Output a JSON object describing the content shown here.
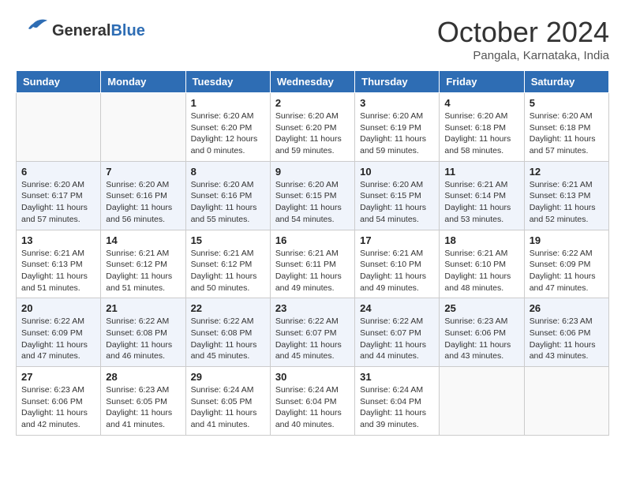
{
  "header": {
    "logo_general": "General",
    "logo_blue": "Blue",
    "month_title": "October 2024",
    "location": "Pangala, Karnataka, India"
  },
  "weekdays": [
    "Sunday",
    "Monday",
    "Tuesday",
    "Wednesday",
    "Thursday",
    "Friday",
    "Saturday"
  ],
  "weeks": [
    [
      {
        "day": "",
        "info": ""
      },
      {
        "day": "",
        "info": ""
      },
      {
        "day": "1",
        "info": "Sunrise: 6:20 AM\nSunset: 6:20 PM\nDaylight: 12 hours\nand 0 minutes."
      },
      {
        "day": "2",
        "info": "Sunrise: 6:20 AM\nSunset: 6:20 PM\nDaylight: 11 hours\nand 59 minutes."
      },
      {
        "day": "3",
        "info": "Sunrise: 6:20 AM\nSunset: 6:19 PM\nDaylight: 11 hours\nand 59 minutes."
      },
      {
        "day": "4",
        "info": "Sunrise: 6:20 AM\nSunset: 6:18 PM\nDaylight: 11 hours\nand 58 minutes."
      },
      {
        "day": "5",
        "info": "Sunrise: 6:20 AM\nSunset: 6:18 PM\nDaylight: 11 hours\nand 57 minutes."
      }
    ],
    [
      {
        "day": "6",
        "info": "Sunrise: 6:20 AM\nSunset: 6:17 PM\nDaylight: 11 hours\nand 57 minutes."
      },
      {
        "day": "7",
        "info": "Sunrise: 6:20 AM\nSunset: 6:16 PM\nDaylight: 11 hours\nand 56 minutes."
      },
      {
        "day": "8",
        "info": "Sunrise: 6:20 AM\nSunset: 6:16 PM\nDaylight: 11 hours\nand 55 minutes."
      },
      {
        "day": "9",
        "info": "Sunrise: 6:20 AM\nSunset: 6:15 PM\nDaylight: 11 hours\nand 54 minutes."
      },
      {
        "day": "10",
        "info": "Sunrise: 6:20 AM\nSunset: 6:15 PM\nDaylight: 11 hours\nand 54 minutes."
      },
      {
        "day": "11",
        "info": "Sunrise: 6:21 AM\nSunset: 6:14 PM\nDaylight: 11 hours\nand 53 minutes."
      },
      {
        "day": "12",
        "info": "Sunrise: 6:21 AM\nSunset: 6:13 PM\nDaylight: 11 hours\nand 52 minutes."
      }
    ],
    [
      {
        "day": "13",
        "info": "Sunrise: 6:21 AM\nSunset: 6:13 PM\nDaylight: 11 hours\nand 51 minutes."
      },
      {
        "day": "14",
        "info": "Sunrise: 6:21 AM\nSunset: 6:12 PM\nDaylight: 11 hours\nand 51 minutes."
      },
      {
        "day": "15",
        "info": "Sunrise: 6:21 AM\nSunset: 6:12 PM\nDaylight: 11 hours\nand 50 minutes."
      },
      {
        "day": "16",
        "info": "Sunrise: 6:21 AM\nSunset: 6:11 PM\nDaylight: 11 hours\nand 49 minutes."
      },
      {
        "day": "17",
        "info": "Sunrise: 6:21 AM\nSunset: 6:10 PM\nDaylight: 11 hours\nand 49 minutes."
      },
      {
        "day": "18",
        "info": "Sunrise: 6:21 AM\nSunset: 6:10 PM\nDaylight: 11 hours\nand 48 minutes."
      },
      {
        "day": "19",
        "info": "Sunrise: 6:22 AM\nSunset: 6:09 PM\nDaylight: 11 hours\nand 47 minutes."
      }
    ],
    [
      {
        "day": "20",
        "info": "Sunrise: 6:22 AM\nSunset: 6:09 PM\nDaylight: 11 hours\nand 47 minutes."
      },
      {
        "day": "21",
        "info": "Sunrise: 6:22 AM\nSunset: 6:08 PM\nDaylight: 11 hours\nand 46 minutes."
      },
      {
        "day": "22",
        "info": "Sunrise: 6:22 AM\nSunset: 6:08 PM\nDaylight: 11 hours\nand 45 minutes."
      },
      {
        "day": "23",
        "info": "Sunrise: 6:22 AM\nSunset: 6:07 PM\nDaylight: 11 hours\nand 45 minutes."
      },
      {
        "day": "24",
        "info": "Sunrise: 6:22 AM\nSunset: 6:07 PM\nDaylight: 11 hours\nand 44 minutes."
      },
      {
        "day": "25",
        "info": "Sunrise: 6:23 AM\nSunset: 6:06 PM\nDaylight: 11 hours\nand 43 minutes."
      },
      {
        "day": "26",
        "info": "Sunrise: 6:23 AM\nSunset: 6:06 PM\nDaylight: 11 hours\nand 43 minutes."
      }
    ],
    [
      {
        "day": "27",
        "info": "Sunrise: 6:23 AM\nSunset: 6:06 PM\nDaylight: 11 hours\nand 42 minutes."
      },
      {
        "day": "28",
        "info": "Sunrise: 6:23 AM\nSunset: 6:05 PM\nDaylight: 11 hours\nand 41 minutes."
      },
      {
        "day": "29",
        "info": "Sunrise: 6:24 AM\nSunset: 6:05 PM\nDaylight: 11 hours\nand 41 minutes."
      },
      {
        "day": "30",
        "info": "Sunrise: 6:24 AM\nSunset: 6:04 PM\nDaylight: 11 hours\nand 40 minutes."
      },
      {
        "day": "31",
        "info": "Sunrise: 6:24 AM\nSunset: 6:04 PM\nDaylight: 11 hours\nand 39 minutes."
      },
      {
        "day": "",
        "info": ""
      },
      {
        "day": "",
        "info": ""
      }
    ]
  ]
}
